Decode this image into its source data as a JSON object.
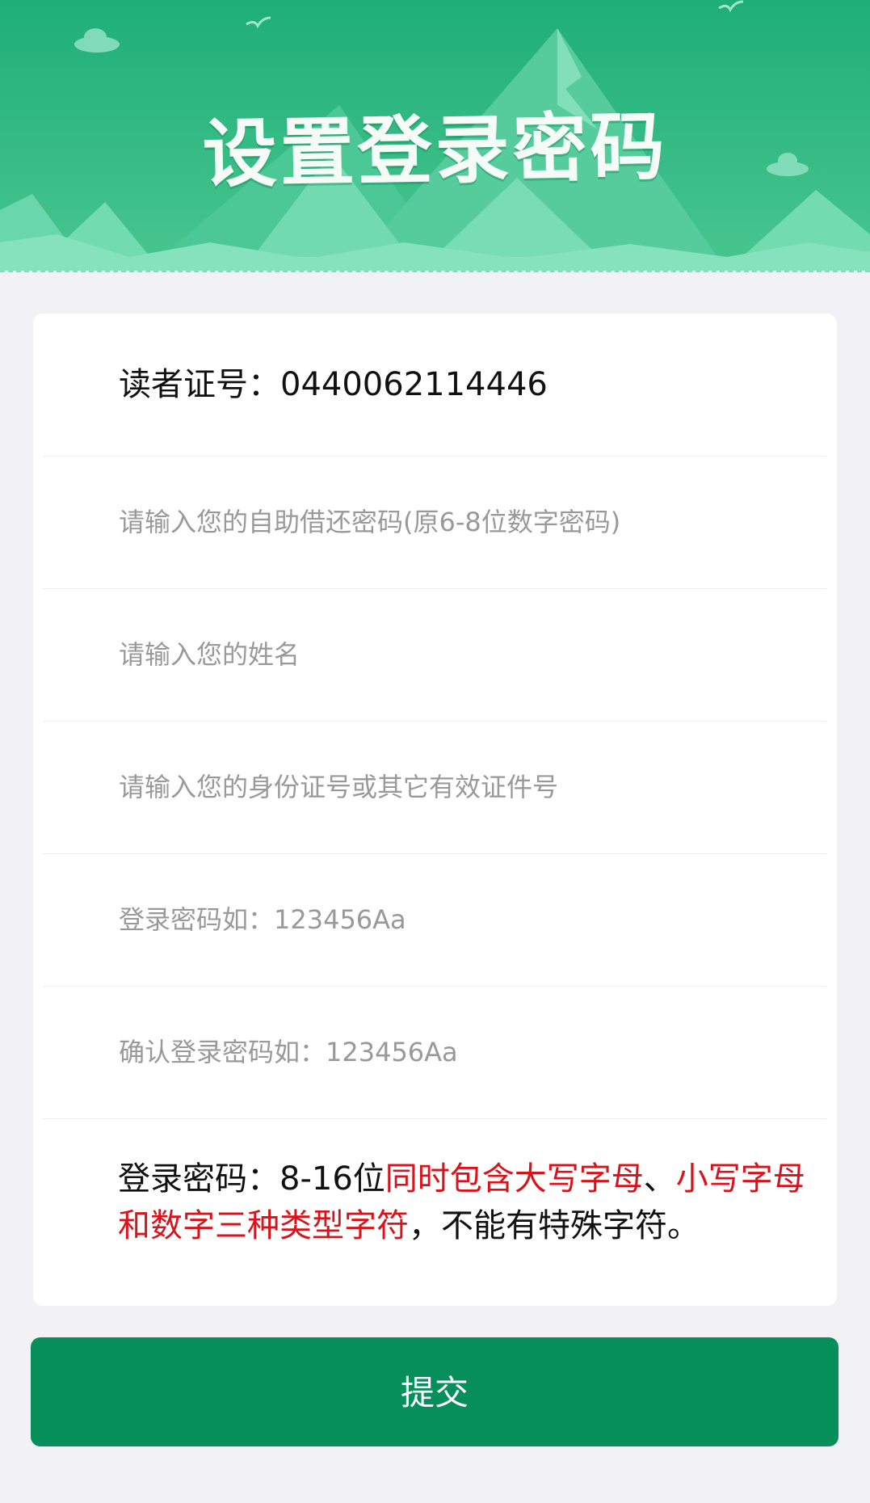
{
  "banner": {
    "title": "设置登录密码",
    "colors": {
      "top": "#21b07a",
      "mountain_light": "#7fe0bb",
      "mountain_mid": "#5fd0a4"
    }
  },
  "form": {
    "card_number_label": "读者证号：",
    "card_number_value": "0440062114446",
    "selfservice_password_placeholder": "请输入您的自助借还密码(原6-8位数字密码)",
    "name_placeholder": "请输入您的姓名",
    "id_placeholder": "请输入您的身份证号或其它有效证件号",
    "login_password_placeholder": "登录密码如：123456Aa",
    "confirm_password_placeholder": "确认登录密码如：123456Aa"
  },
  "note": {
    "part1": "登录密码：8-16位",
    "part2_red": "同时包含大写字母",
    "part3": "、",
    "part4_red": "小写字母和数字三种类型字符",
    "part5": "，不能有特殊字符。"
  },
  "submit_label": "提交",
  "colors": {
    "accent": "#068f5b",
    "warning": "#d9131b",
    "placeholder": "#999999"
  }
}
